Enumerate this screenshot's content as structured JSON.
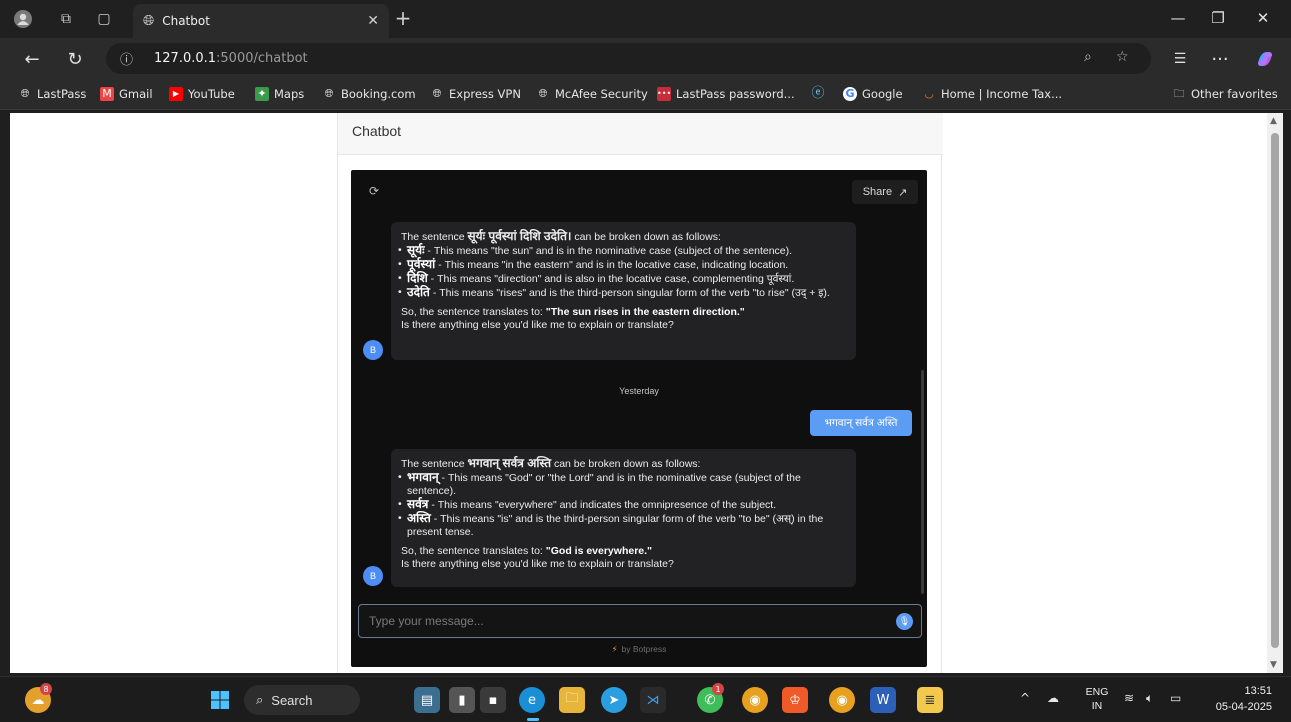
{
  "browser": {
    "tab_title": "Chatbot",
    "url_host": "127.0.0.1",
    "url_path": ":5000/chatbot",
    "favorites": [
      {
        "label": "LastPass",
        "icon": "globe-icon"
      },
      {
        "label": "Gmail",
        "icon": "gmail-icon"
      },
      {
        "label": "YouTube",
        "icon": "youtube-icon"
      },
      {
        "label": "Maps",
        "icon": "maps-icon"
      },
      {
        "label": "Booking.com",
        "icon": "globe-icon"
      },
      {
        "label": "Express VPN",
        "icon": "globe-icon"
      },
      {
        "label": "McAfee Security",
        "icon": "globe-icon"
      },
      {
        "label": "LastPass password...",
        "icon": "lastpass-icon"
      },
      {
        "label": "",
        "icon": "edge-icon"
      },
      {
        "label": "Google",
        "icon": "google-icon"
      },
      {
        "label": "Home | Income Tax...",
        "icon": "income-tax-icon"
      }
    ],
    "other_favorites": "Other favorites"
  },
  "page": {
    "title": "Chatbot"
  },
  "chat": {
    "share_label": "Share",
    "messages": {
      "m1": {
        "intro_pre": "The sentence ",
        "intro_deva": "सूर्यः पूर्वस्यां दिशि उदेति।",
        "intro_post": " can be broken down as follows:",
        "items": [
          {
            "term": "सूर्यः",
            "text": " - This means \"the sun\" and is in the nominative case (subject of the sentence)."
          },
          {
            "term": "पूर्वस्यां",
            "text": " - This means \"in the eastern\" and is in the locative case, indicating location."
          },
          {
            "term": "दिशि",
            "text": " - This means \"direction\" and is also in the locative case, complementing पूर्वस्यां."
          },
          {
            "term": "उदेति",
            "text": " - This means \"rises\" and is the third-person singular form of the verb \"to rise\" (उद् + इ)."
          }
        ],
        "so_pre": "So, the sentence translates to: ",
        "so_bold": "\"The sun rises in the eastern direction.\"",
        "question": "Is there anything else you'd like me to explain or translate?"
      },
      "date_separator": "Yesterday",
      "user_message": "भगवान् सर्वत्र अस्ति",
      "m2": {
        "intro_pre": "The sentence ",
        "intro_deva": "भगवान् सर्वत्र अस्ति",
        "intro_post": " can be broken down as follows:",
        "items": [
          {
            "term": "भगवान्",
            "text": " - This means \"God\" or \"the Lord\" and is in the nominative case (subject of the sentence)."
          },
          {
            "term": "सर्वत्र",
            "text": " - This means \"everywhere\" and indicates the omnipresence of the subject."
          },
          {
            "term": "अस्ति",
            "text": " - This means \"is\" and is the third-person singular form of the verb \"to be\" (अस्) in the present tense."
          }
        ],
        "so_pre": "So, the sentence translates to: ",
        "so_bold": "\"God is everywhere.\"",
        "question": "Is there anything else you'd like me to explain or translate?"
      }
    },
    "avatar_letter": "B",
    "input_placeholder": "Type your message...",
    "powered_by": "by Botpress"
  },
  "taskbar": {
    "search_label": "Search",
    "weather_badge": "8",
    "whatsapp_badge": "1",
    "lang_top": "ENG",
    "lang_bottom": "IN",
    "time": "13:51",
    "date": "05-04-2025"
  },
  "colors": {
    "accent": "#5b9cf4",
    "chat_bg": "#0f0f10",
    "bubble_bg": "#222224"
  }
}
